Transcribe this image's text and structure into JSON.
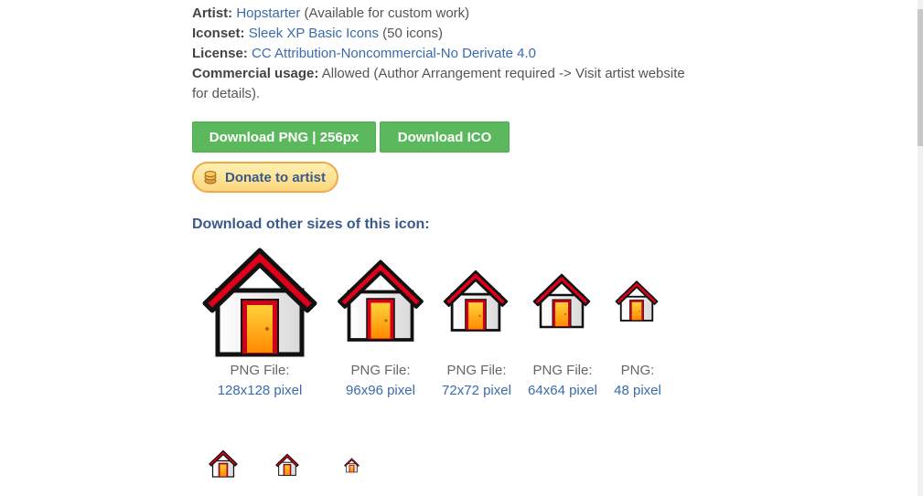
{
  "meta": {
    "artist_label": "Artist:",
    "artist_value": "Hopstarter",
    "artist_note": " (Available for custom work)",
    "iconset_label": "Iconset:",
    "iconset_value": "Sleek XP Basic Icons",
    "iconset_note": " (50 icons)",
    "license_label": "License:",
    "license_value": "CC Attribution-Noncommercial-No Derivate 4.0",
    "commercial_label": "Commercial usage:",
    "commercial_value": " Allowed (Author Arrangement required -> Visit artist website for details)."
  },
  "buttons": {
    "download_png": "Download PNG | 256px",
    "download_ico": "Download ICO",
    "donate": "Donate to artist"
  },
  "sizes": {
    "heading": "Download other sizes of this icon:",
    "items": [
      {
        "type": "PNG File:",
        "size": "128x128 pixel"
      },
      {
        "type": "PNG File:",
        "size": "96x96 pixel"
      },
      {
        "type": "PNG File:",
        "size": "72x72 pixel"
      },
      {
        "type": "PNG File:",
        "size": "64x64 pixel"
      },
      {
        "type": "PNG:",
        "size": "48 pixel"
      }
    ]
  },
  "icon": "house-icon",
  "colors": {
    "button_green": "#5cb85c",
    "link_blue": "#3a6bad",
    "heading_blue": "#3a5a8c",
    "roof_red": "#e0001a",
    "door_orange": "#ffb800"
  }
}
